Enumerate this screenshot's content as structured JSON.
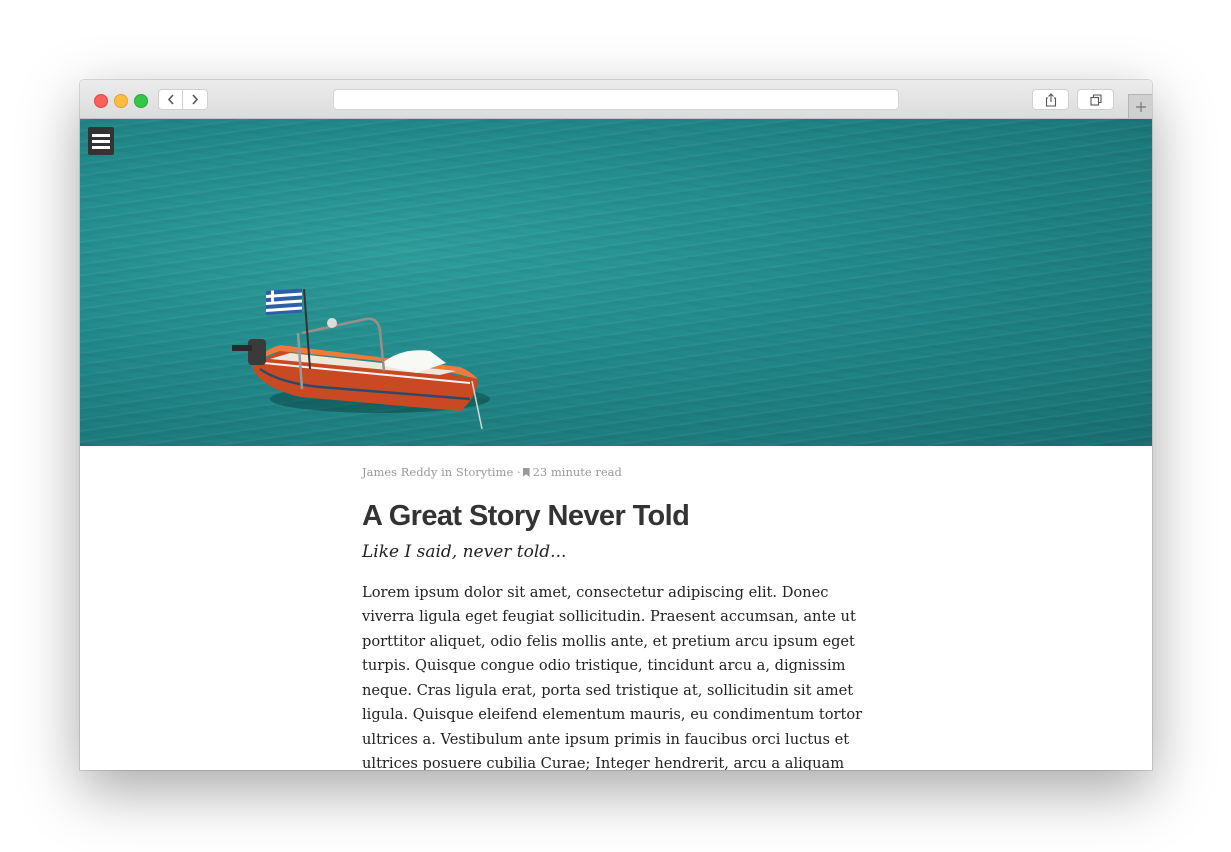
{
  "browser": {
    "address_value": "",
    "back_icon": "chevron-left-icon",
    "forward_icon": "chevron-right-icon",
    "share_icon": "share-icon",
    "tabs_icon": "tabs-overview-icon",
    "newtab_icon": "plus-icon",
    "colors": {
      "close": "#fc605c",
      "minimize": "#fdbc40",
      "maximize": "#34c84a"
    }
  },
  "hero": {
    "menu_icon": "hamburger-menu-icon",
    "image": "boat-on-sea-photo",
    "colors": {
      "water": "#22898a",
      "boat": "#e2562a"
    }
  },
  "article": {
    "author": "James Reddy",
    "in_text": "in",
    "category": "Storytime",
    "separator": "·",
    "read_time": "23 minute read",
    "title": "A Great Story Never Told",
    "subtitle": "Like I said, never told...",
    "body": "Lorem ipsum dolor sit amet, consectetur adipiscing elit. Donec viverra ligula eget feugiat sollicitudin. Praesent accumsan, ante ut porttitor aliquet, odio felis mollis ante, et pretium arcu ipsum eget turpis. Quisque congue odio tristique, tincidunt arcu a, dignissim neque. Cras ligula erat, porta sed tristique at, sollicitudin sit amet ligula. Quisque eleifend elementum mauris, eu condimentum tortor ultrices a. Vestibulum ante ipsum primis in faucibus orci luctus et ultrices posuere cubilia Curae; Integer hendrerit, arcu a aliquam malesuada, sapien quam tempor neque,"
  }
}
